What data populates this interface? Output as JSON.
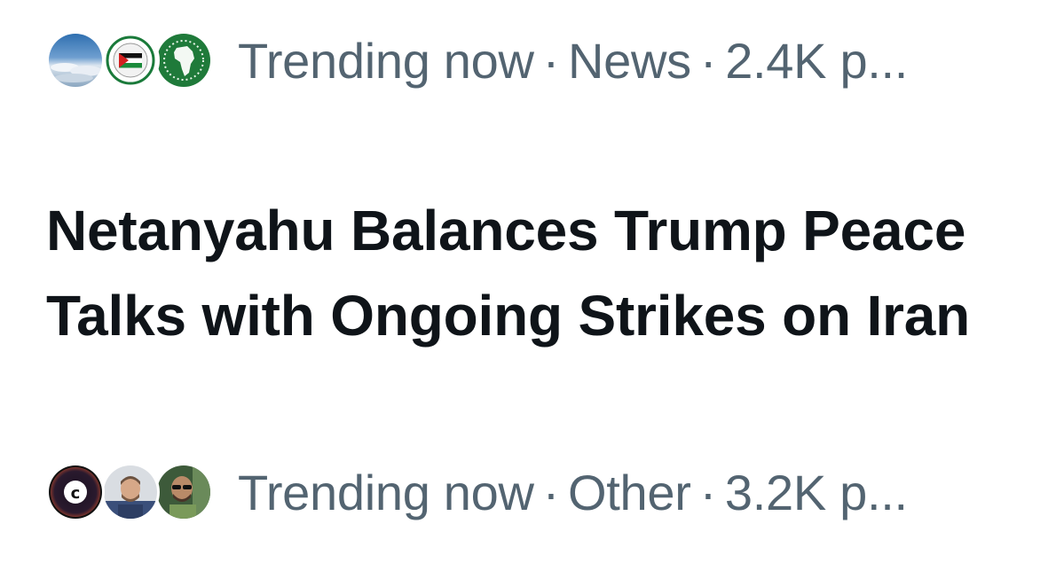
{
  "trend_top": {
    "label": "Trending now",
    "separator": "·",
    "category": "News",
    "count": "2.4K p..."
  },
  "headline": {
    "text": "Netanyahu Balances Trump Peace Talks with Ongoing Strikes on Iran"
  },
  "trend_bottom": {
    "label": "Trending now",
    "separator": "·",
    "category": "Other",
    "count": "3.2K p..."
  },
  "colors": {
    "meta_text": "#536471",
    "headline_text": "#0f1419",
    "background": "#ffffff"
  },
  "icons": [
    "sky-avatar-icon",
    "palestine-flag-avatar-icon",
    "africa-map-avatar-icon",
    "c-logo-avatar-icon",
    "man-photo-avatar-icon",
    "man-sunglasses-avatar-icon"
  ]
}
